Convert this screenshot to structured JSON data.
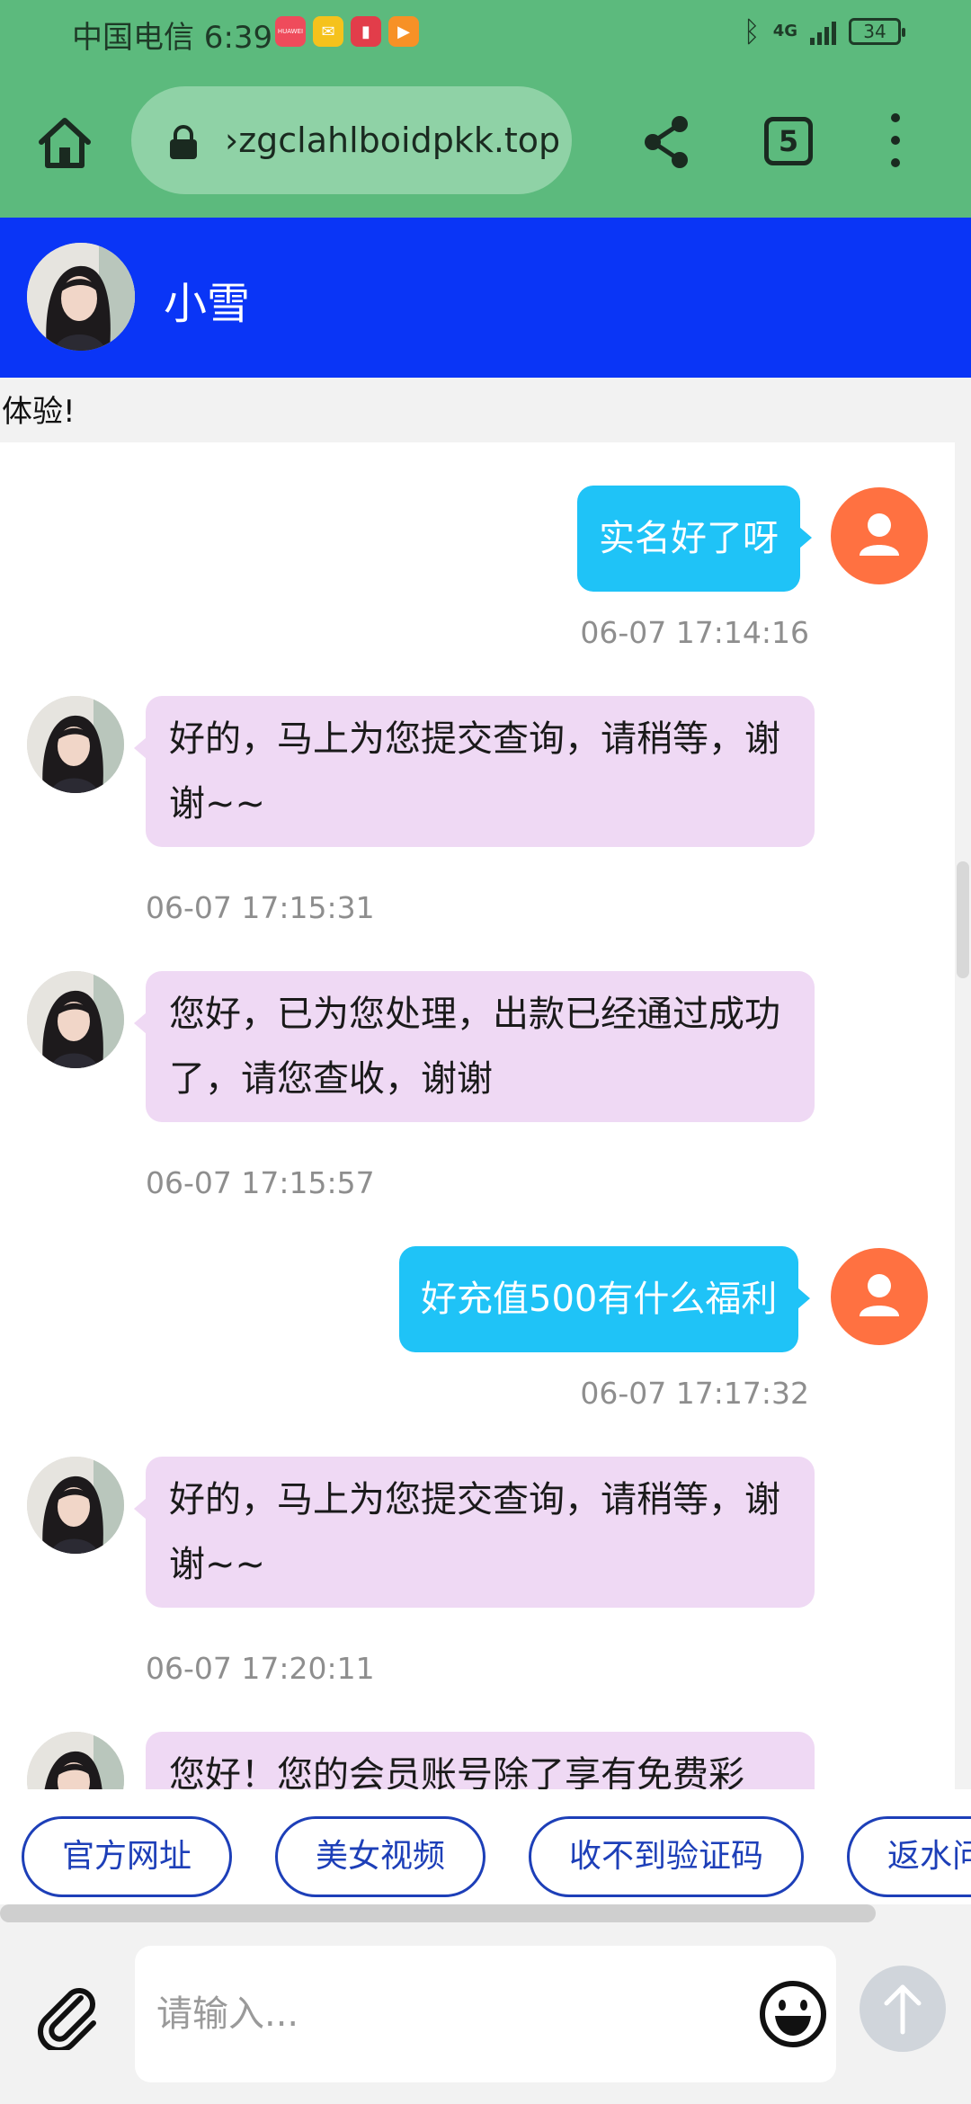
{
  "status_bar": {
    "carrier_time": "中国电信 6:39",
    "network": "4G",
    "battery": "34",
    "app_badges": [
      {
        "name": "huawei-icon",
        "text": "HUAWEI",
        "color": "#ef4b5b"
      },
      {
        "name": "mail-icon",
        "text": "✉",
        "color": "#f5c21c"
      },
      {
        "name": "book-icon",
        "text": "▮",
        "color": "#e23d4a"
      },
      {
        "name": "video-icon",
        "text": "▶",
        "color": "#f79126"
      }
    ]
  },
  "browser": {
    "url": "›zgclahlboidpkk.top",
    "tab_count": "5"
  },
  "chat": {
    "contact_name": "小雪",
    "notice": "体验!",
    "messages": [
      {
        "from": "user",
        "text": "实名好了呀",
        "time": "06-07 17:14:16"
      },
      {
        "from": "agent",
        "text": "好的，马上为您提交查询，请稍等，谢谢~~",
        "time": "06-07 17:15:31"
      },
      {
        "from": "agent",
        "text": "您好，已为您处理，出款已经通过成功了，请您查收，谢谢",
        "time": "06-07 17:15:57"
      },
      {
        "from": "user",
        "text": "好充值500有什么福利",
        "time": "06-07 17:17:32"
      },
      {
        "from": "agent",
        "text": "好的，马上为您提交查询，请稍等，谢谢~~",
        "time": "06-07 17:20:11"
      },
      {
        "from": "agent",
        "text": "您好！您的会员账号除了享有免费彩"
      }
    ]
  },
  "quick_replies": [
    "官方网址",
    "美女视频",
    "收不到验证码",
    "返水问题"
  ],
  "composer": {
    "placeholder": "请输入..."
  },
  "colors": {
    "browser_bar": "#5cba7d",
    "chat_header": "#0a35f6",
    "user_bubble": "#1fc3f7",
    "agent_bubble": "#efd9f4",
    "user_avatar": "#ff7141",
    "quick_reply_border": "#1d3fb8"
  }
}
